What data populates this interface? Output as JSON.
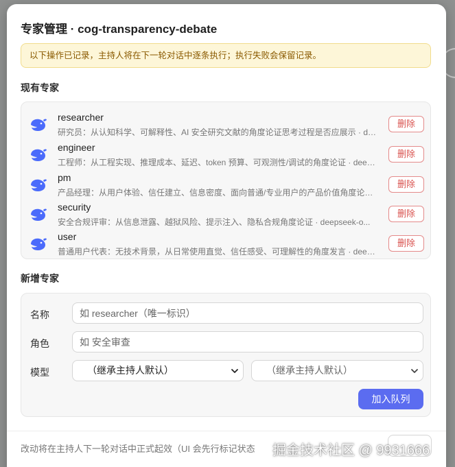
{
  "modal": {
    "title": "专家管理 · cog-transparency-debate",
    "notice": "以下操作已记录，主持人将在下一轮对话中逐条执行；执行失败会保留记录。"
  },
  "existing": {
    "section_title": "现有专家",
    "delete_label": "删除",
    "experts": [
      {
        "name": "researcher",
        "desc": "研究员：从认知科学、可解释性、AI 安全研究文献的角度论证思考过程是否应展示 · deepseek",
        "icon": "whale-icon"
      },
      {
        "name": "engineer",
        "desc": "工程师：从工程实现、推理成本、延迟、token 预算、可观测性/调试的角度论证 · deepseek",
        "icon": "whale-icon"
      },
      {
        "name": "pm",
        "desc": "产品经理：从用户体验、信任建立、信息密度、面向普通/专业用户的产品价值角度论证 · deepseek",
        "icon": "whale-icon"
      },
      {
        "name": "security",
        "desc": "安全合规评审：从信息泄露、越狱风险、提示注入、隐私合规角度论证 · deepseek-o...",
        "icon": "whale-icon"
      },
      {
        "name": "user",
        "desc": "普通用户代表：无技术背景，从日常使用直觉、信任感受、可理解性的角度发言 · deepseek",
        "icon": "whale-icon"
      }
    ]
  },
  "add": {
    "section_title": "新增专家",
    "name_label": "名称",
    "name_placeholder": "如 researcher（唯一标识）",
    "role_label": "角色",
    "role_placeholder": "如 安全审查",
    "model_label": "模型",
    "model_select_1": "（继承主持人默认）",
    "model_select_2": "（继承主持人默认）",
    "add_button": "加入队列"
  },
  "footer": {
    "text": "改动将在主持人下一轮对话中正式起效（UI 会先行标记状态",
    "watermark": "掘金技术社区 @ 9931666"
  },
  "colors": {
    "accent": "#5b6cf0",
    "danger": "#d9534f",
    "whale": "#4b6bfb",
    "notice_bg": "#fdf6d8"
  }
}
